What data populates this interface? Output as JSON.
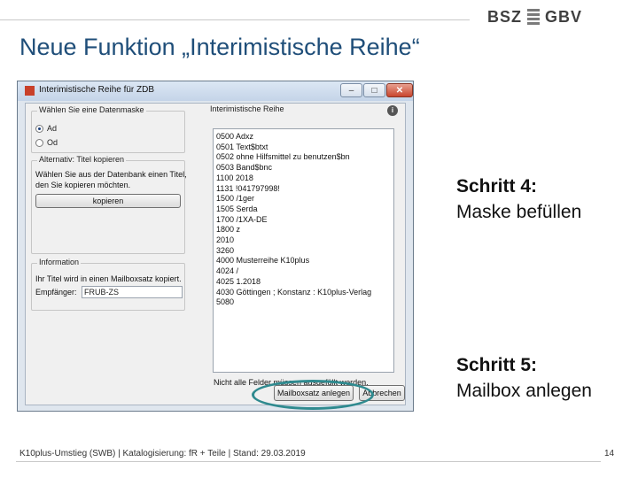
{
  "header": {
    "logo_left": "BSZ",
    "logo_right": "GBV",
    "title": "Neue Funktion „Interimistische Reihe“"
  },
  "window": {
    "title": "Interimistische Reihe für ZDB",
    "minimize_glyph": "–",
    "maximize_glyph": "□",
    "close_glyph": "✕",
    "mask_group": {
      "legend": "Wählen Sie eine Datenmaske",
      "options": [
        "Ad",
        "Od"
      ],
      "selected": "Ad"
    },
    "copy_group": {
      "legend": "Alternativ: Titel kopieren",
      "text_line1": "Wählen Sie aus der Datenbank einen Titel,",
      "text_line2": "den Sie kopieren möchten.",
      "button": "kopieren"
    },
    "info_group": {
      "legend": "Information",
      "text": "Ihr Titel wird in einen Mailboxsatz kopiert.",
      "recipient_label": "Empfänger:",
      "recipient_value": "FRUB-ZS"
    },
    "series_group": {
      "legend": "Interimistische Reihe",
      "info_icon": "i",
      "rows": [
        "0500 Adxz",
        "0501 Text$btxt",
        "0502 ohne Hilfsmittel zu benutzen$bn",
        "0503 Band$bnc",
        "1100 2018",
        "1131 !041797998!",
        "1500 /1ger",
        "1505 Serda",
        "1700 /1XA-DE",
        "1800 z",
        "2010",
        "3260",
        "4000 Musterreihe K10plus",
        "4024 /",
        "4025 1.2018",
        "4030 Göttingen ; Konstanz : K10plus-Verlag",
        "5080"
      ],
      "note": "Nicht alle Felder müssen ausgefüllt werden."
    },
    "buttons": {
      "mailbox": "Mailboxsatz anlegen",
      "cancel": "Abbrechen"
    }
  },
  "steps": {
    "step4_title": "Schritt 4:",
    "step4_text": "Maske befüllen",
    "step5_title": "Schritt 5:",
    "step5_text": "Mailbox anlegen"
  },
  "footer": {
    "text": "K10plus-Umstieg (SWB) | Katalogisierung: fR + Teile | Stand: 29.03.2019",
    "page": "14"
  },
  "colors": {
    "title": "#1f4e79",
    "highlight_ring": "#2f8a8f"
  }
}
